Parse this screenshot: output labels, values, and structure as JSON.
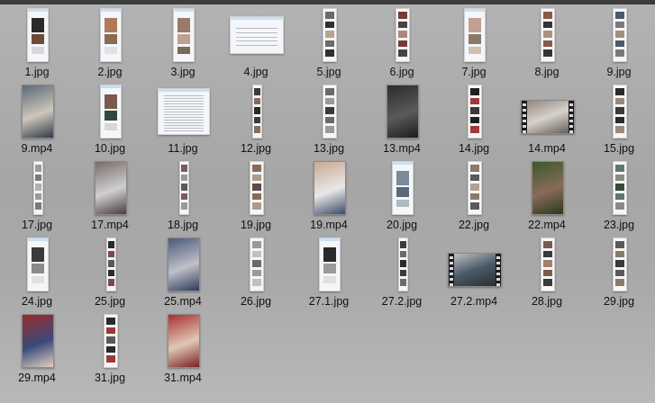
{
  "window": {
    "view": "large-icons"
  },
  "files": [
    {
      "name": "1.jpg",
      "kind": "doc",
      "colors": [
        "#2a2a2a",
        "#6b4a3a",
        "#d8d8d8"
      ]
    },
    {
      "name": "2.jpg",
      "kind": "doc",
      "colors": [
        "#b07a5a",
        "#8a6a50",
        "#e2e2e2"
      ]
    },
    {
      "name": "3.jpg",
      "kind": "doc",
      "colors": [
        "#9a7a6a",
        "#c0a090",
        "#7a6a5a"
      ]
    },
    {
      "name": "4.jpg",
      "kind": "wide",
      "colors": [
        "#5a5a5a",
        "#9a9a9a"
      ]
    },
    {
      "name": "5.jpg",
      "kind": "strip",
      "colors": [
        "#6a6a6a",
        "#2f2f2f",
        "#b9a48f"
      ]
    },
    {
      "name": "6.jpg",
      "kind": "strip",
      "colors": [
        "#7a3a3a",
        "#444444",
        "#a88a7a"
      ]
    },
    {
      "name": "7.jpg",
      "kind": "doc",
      "colors": [
        "#c0a090",
        "#8a7a6a",
        "#d0c0b0"
      ]
    },
    {
      "name": "8.jpg",
      "kind": "strip",
      "colors": [
        "#8a5a4a",
        "#333333",
        "#b09080"
      ]
    },
    {
      "name": "9.jpg",
      "kind": "strip",
      "colors": [
        "#4a5a6a",
        "#7a7a7a",
        "#a09080"
      ]
    },
    {
      "name": "9.mp4",
      "kind": "photo",
      "colors": [
        "#5a6a7a",
        "#cfc6bb",
        "#2f3a48"
      ]
    },
    {
      "name": "10.jpg",
      "kind": "doc",
      "colors": [
        "#7a5a4a",
        "#2f4a3a",
        "#d8d8d8"
      ]
    },
    {
      "name": "11.jpg",
      "kind": "textdoc",
      "colors": [
        "#888888"
      ]
    },
    {
      "name": "12.jpg",
      "kind": "strip",
      "colors": [
        "#3a3a3a",
        "#8a6a5a",
        "#2a2a2a"
      ]
    },
    {
      "name": "13.jpg",
      "kind": "strip",
      "colors": [
        "#6a6a6a",
        "#9a9a9a",
        "#3a3a3a"
      ]
    },
    {
      "name": "13.mp4",
      "kind": "photo",
      "colors": [
        "#2b2b2b",
        "#5a5a5a",
        "#1c1c1c"
      ]
    },
    {
      "name": "14.jpg",
      "kind": "strip",
      "colors": [
        "#1f1f1f",
        "#a03a3a",
        "#3a3a3a"
      ]
    },
    {
      "name": "14.mp4",
      "kind": "video",
      "colors": [
        "#d8d2cc",
        "#8a8078",
        "#5a5450"
      ]
    },
    {
      "name": "15.jpg",
      "kind": "strip",
      "colors": [
        "#2a2a2a",
        "#9a8a7a",
        "#3a3a3a"
      ]
    },
    {
      "name": "17.jpg",
      "kind": "strip",
      "colors": [
        "#9a9a9a",
        "#7a7a7a",
        "#b0b0b0"
      ]
    },
    {
      "name": "17.mp4",
      "kind": "photo",
      "colors": [
        "#7a6a6a",
        "#cfcfcf",
        "#4a3a3a"
      ]
    },
    {
      "name": "18.jpg",
      "kind": "strip",
      "colors": [
        "#7a5a5a",
        "#9a9a9a",
        "#5a5a5a"
      ]
    },
    {
      "name": "19.jpg",
      "kind": "strip",
      "colors": [
        "#8a6a5a",
        "#b09a8a",
        "#5a4a4a"
      ]
    },
    {
      "name": "19.mp4",
      "kind": "photo",
      "colors": [
        "#c8a890",
        "#e8e8e8",
        "#3a4a6a"
      ]
    },
    {
      "name": "20.jpg",
      "kind": "doc",
      "colors": [
        "#7a8a9a",
        "#5a6a7a",
        "#b0b8c0"
      ]
    },
    {
      "name": "22.jpg",
      "kind": "strip",
      "colors": [
        "#8a7a6a",
        "#5a5a5a",
        "#b0a090"
      ]
    },
    {
      "name": "22.mp4",
      "kind": "photo",
      "colors": [
        "#3a5a2a",
        "#8a6a5a",
        "#2a3a1a"
      ]
    },
    {
      "name": "23.jpg",
      "kind": "strip",
      "colors": [
        "#5a7a6a",
        "#8a8a8a",
        "#3a4a3a"
      ]
    },
    {
      "name": "24.jpg",
      "kind": "doc",
      "colors": [
        "#3a3a3a",
        "#8a8a8a",
        "#e0e0e0"
      ]
    },
    {
      "name": "25.jpg",
      "kind": "strip",
      "colors": [
        "#2a2a2a",
        "#7a4a4a",
        "#5a5a5a"
      ]
    },
    {
      "name": "25.mp4",
      "kind": "photo",
      "colors": [
        "#4a5a7a",
        "#c0c0c8",
        "#2a3a5a"
      ]
    },
    {
      "name": "26.jpg",
      "kind": "strip",
      "colors": [
        "#9a9a9a",
        "#c0c0c0",
        "#6a6a6a"
      ]
    },
    {
      "name": "27.1.jpg",
      "kind": "doc",
      "colors": [
        "#2a2a2a",
        "#9a9a9a",
        "#e0e0e0"
      ]
    },
    {
      "name": "27.2.jpg",
      "kind": "strip",
      "colors": [
        "#3a3a3a",
        "#6a6a6a",
        "#2a2a2a"
      ]
    },
    {
      "name": "27.2.mp4",
      "kind": "video",
      "colors": [
        "#4a5a6a",
        "#c8c8c8",
        "#2a2a2a"
      ]
    },
    {
      "name": "28.jpg",
      "kind": "strip",
      "colors": [
        "#7a5a4a",
        "#3a3a3a",
        "#a08070"
      ]
    },
    {
      "name": "29.jpg",
      "kind": "strip",
      "colors": [
        "#5a5a5a",
        "#8a7a6a",
        "#3a3a3a"
      ]
    },
    {
      "name": "29.mp4",
      "kind": "photo",
      "colors": [
        "#9a2a2a",
        "#3a4a7a",
        "#e0d0c0"
      ]
    },
    {
      "name": "31.jpg",
      "kind": "strip",
      "colors": [
        "#2a2a2a",
        "#9a3a3a",
        "#5a5a5a"
      ]
    },
    {
      "name": "31.mp4",
      "kind": "photo",
      "colors": [
        "#a83030",
        "#e0c8b8",
        "#7a2020"
      ]
    }
  ]
}
